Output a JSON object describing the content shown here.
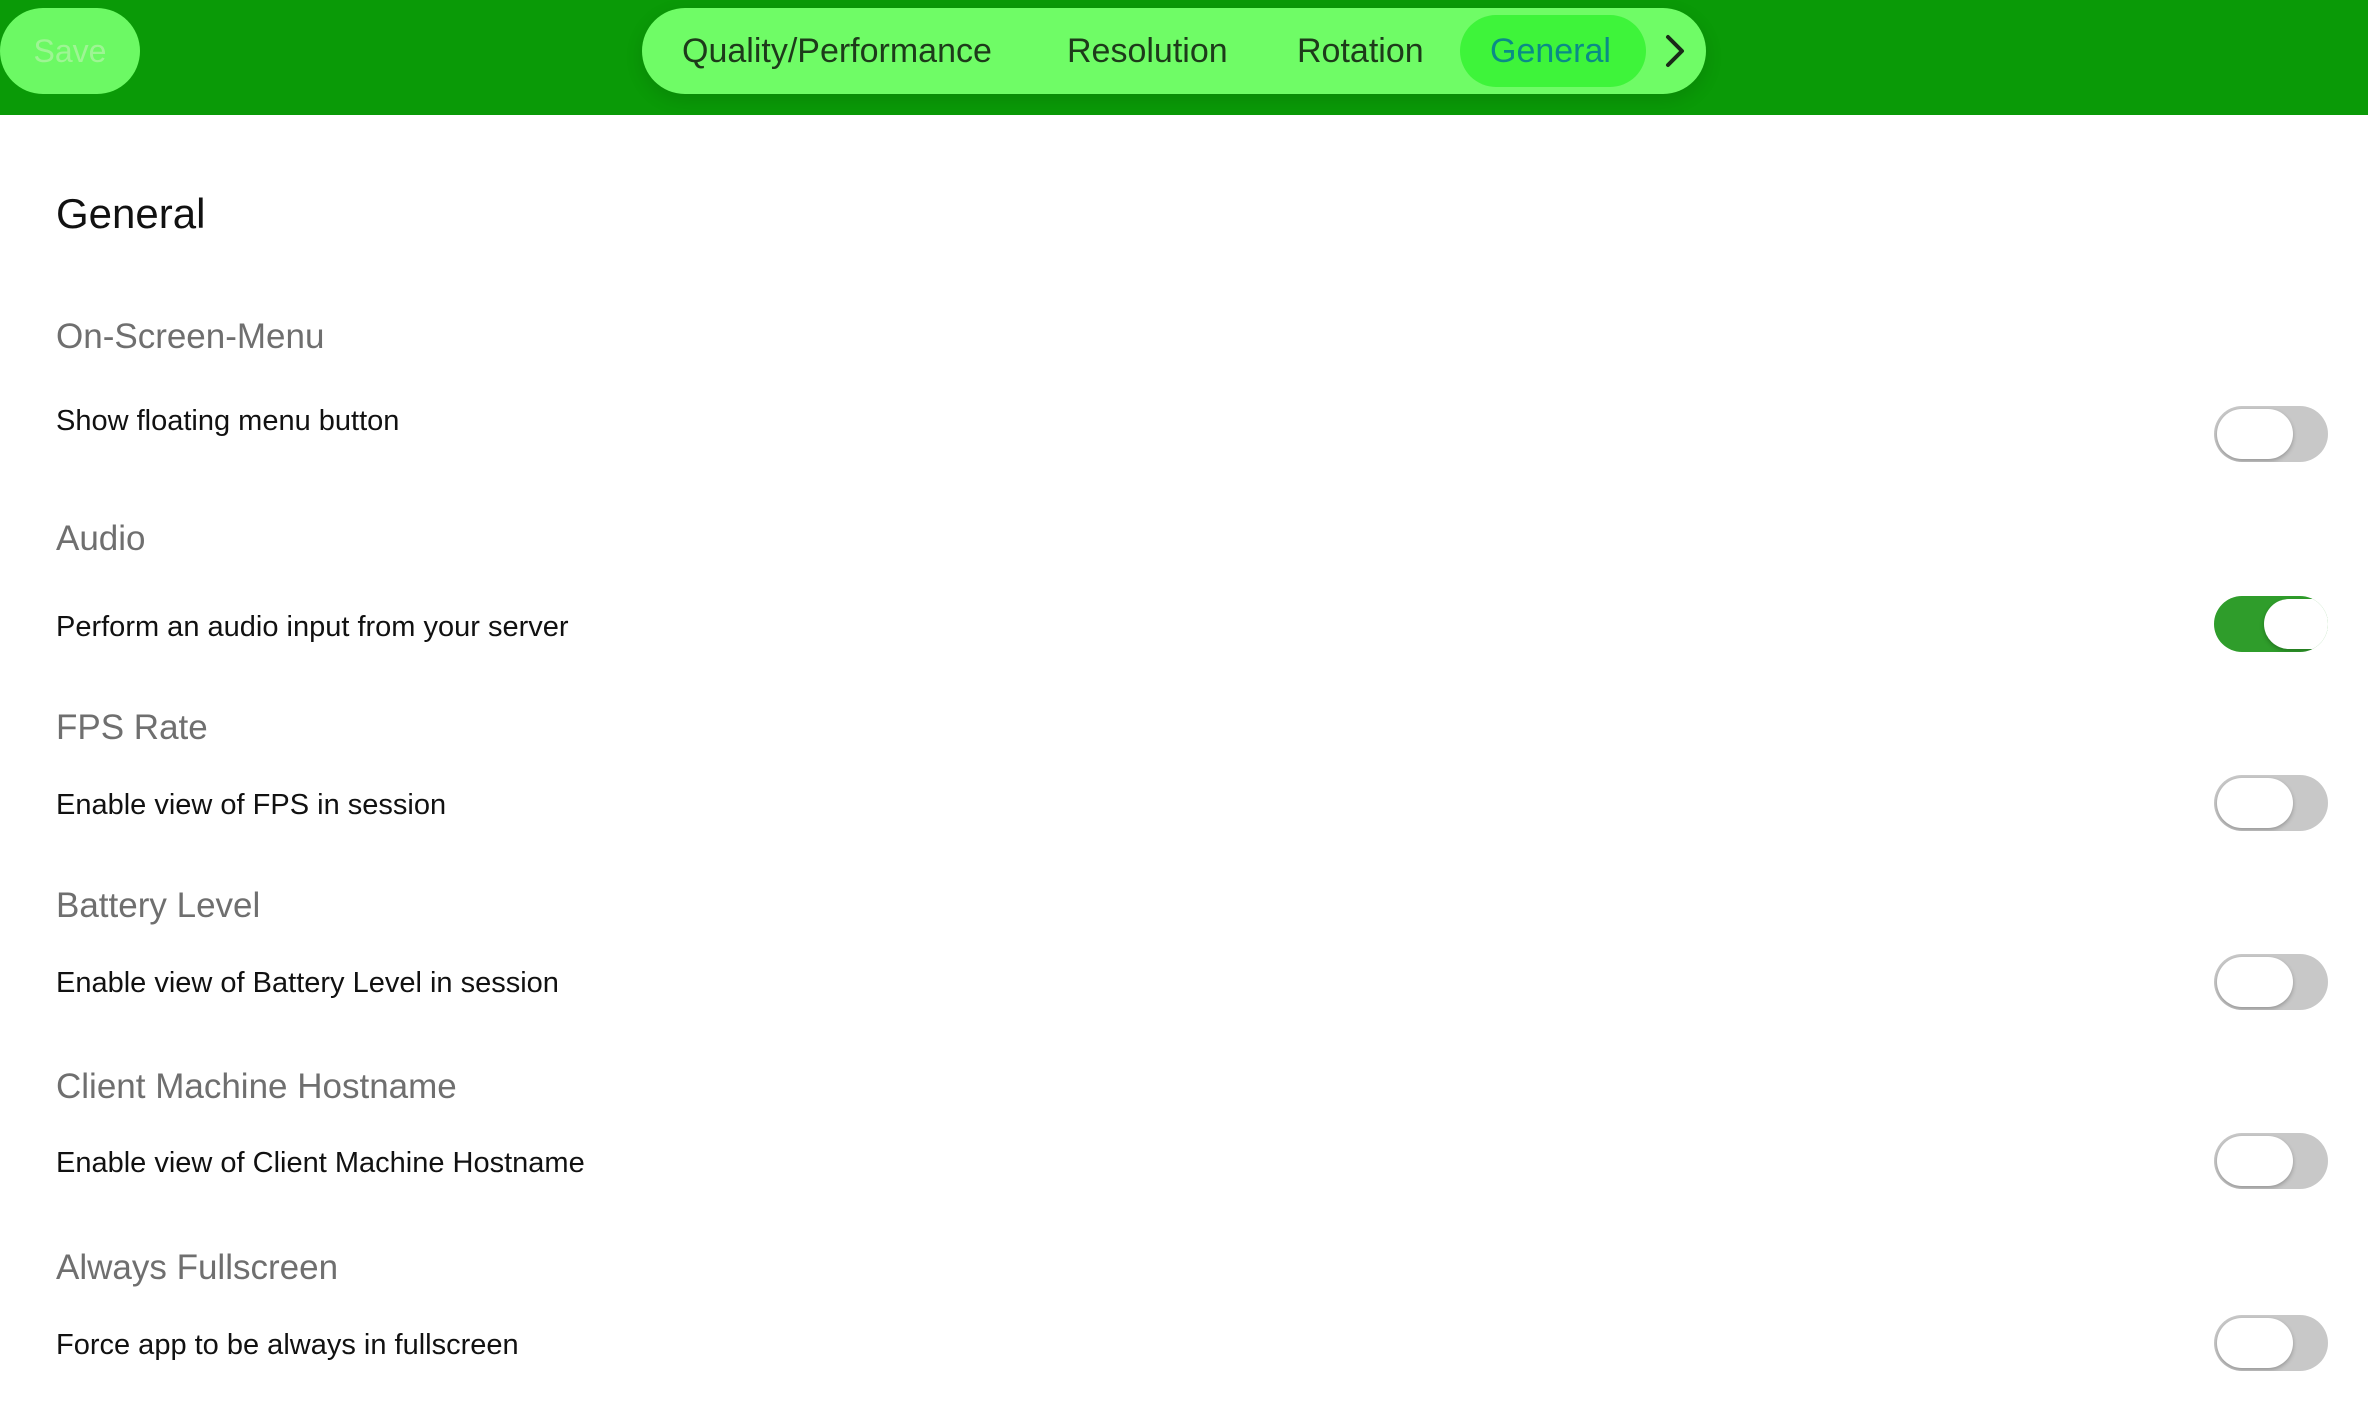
{
  "header": {
    "save_label": "Save",
    "tabs": [
      {
        "label": "Quality/Performance"
      },
      {
        "label": "Resolution"
      },
      {
        "label": "Rotation"
      },
      {
        "label": "General",
        "active": true
      }
    ],
    "next_icon": "chevron-right-icon"
  },
  "colors": {
    "header_bg": "#0a9a07",
    "tabbar_bg": "#6ffc66",
    "active_tab_bg": "#3ef43a",
    "active_tab_text": "#0a8c86",
    "toggle_on": "#2f9d2b",
    "toggle_off": "#c8c8c8"
  },
  "page": {
    "title": "General",
    "sections": [
      {
        "header": "On-Screen-Menu",
        "label": "Show floating menu button",
        "enabled": false
      },
      {
        "header": "Audio",
        "label": "Perform an audio input from your server",
        "enabled": true
      },
      {
        "header": "FPS Rate",
        "label": "Enable view of FPS in session",
        "enabled": false
      },
      {
        "header": "Battery Level",
        "label": "Enable view of Battery Level in session",
        "enabled": false
      },
      {
        "header": "Client Machine Hostname",
        "label": "Enable view of Client Machine Hostname",
        "enabled": false
      },
      {
        "header": "Always Fullscreen",
        "label": "Force app to be always in fullscreen",
        "enabled": false
      }
    ]
  }
}
